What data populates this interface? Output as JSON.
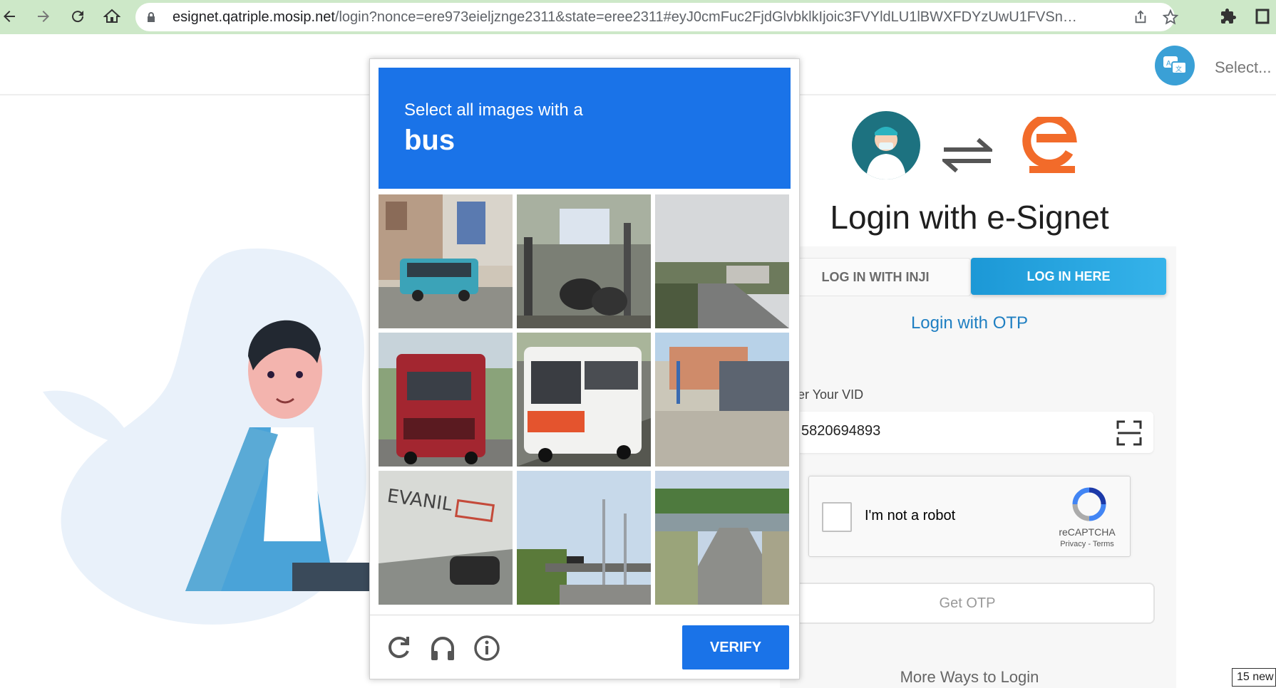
{
  "browser": {
    "url_host": "esignet.qatriple.mosip.net",
    "url_rest": "/login?nonce=ere973eieljznge2311&state=eree2311#eyJ0cmFuc2FjdGlvbklkIjoic3FVYldLU1lBWXFDYzUwU1FVSnBtYn...",
    "icons": [
      "back-arrow-icon",
      "forward-arrow-icon",
      "reload-icon",
      "home-icon",
      "lock-icon",
      "share-icon",
      "star-icon",
      "extensions-icon",
      "window-icon"
    ]
  },
  "header": {
    "language_placeholder": "Select..."
  },
  "login": {
    "title": "Login with e-Signet",
    "tabs": [
      "LOG IN WITH INJI",
      "LOG IN HERE"
    ],
    "subtitle": "Login with OTP",
    "vid_label": "nter Your VID",
    "vid_value": "5820694893",
    "recaptcha_label": "I'm not a robot",
    "recaptcha_brand": "reCAPTCHA",
    "recaptcha_links": "Privacy - Terms",
    "get_otp": "Get OTP",
    "more_ways": "More Ways to Login"
  },
  "captcha": {
    "instruction": "Select all images with a",
    "target": "bus",
    "verify_label": "VERIFY",
    "accent": "#1a73e8"
  },
  "toast": "15 new"
}
